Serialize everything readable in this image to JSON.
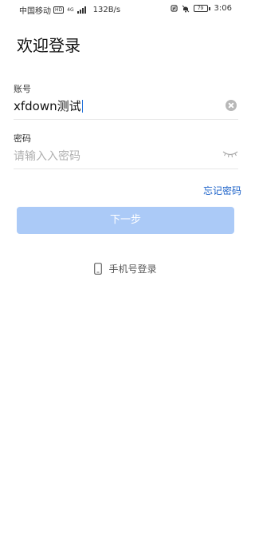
{
  "status_bar": {
    "carrier": "中国移动",
    "carrier_badge": "HD",
    "network_type": "4G",
    "net_speed": "132B/s",
    "battery_level": "79",
    "time": "3:06",
    "icons": [
      "nfc-icon",
      "mute-icon",
      "battery-icon"
    ]
  },
  "page": {
    "title": "欢迎登录"
  },
  "account": {
    "label": "账号",
    "value": "xfdown测试",
    "clear_icon": "clear-circle-icon"
  },
  "password": {
    "label": "密码",
    "placeholder": "请输入入密码",
    "toggle_icon": "eye-closed-icon"
  },
  "forgot_password": "忘记密码",
  "next_button": "下一步",
  "phone_login": {
    "label": "手机号登录",
    "icon": "phone-icon"
  },
  "colors": {
    "accent_link": "#1e63c9",
    "button_disabled_bg": "#abcaf7",
    "caret": "#1e6fd9"
  }
}
